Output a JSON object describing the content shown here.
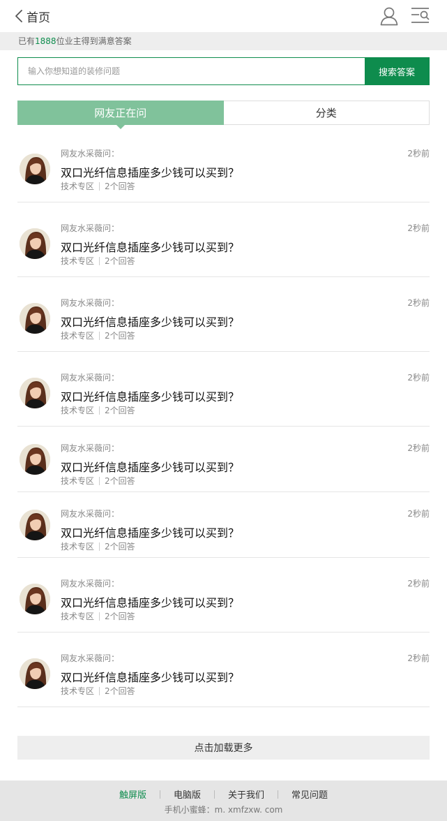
{
  "header": {
    "back_label": "首页",
    "icons": [
      "chevron-left-icon",
      "user-icon",
      "menu-search-icon"
    ]
  },
  "stats": {
    "prefix": "已有",
    "count": "1888",
    "suffix": "位业主得到满意答案"
  },
  "search": {
    "placeholder": "输入你想知道的装修问题",
    "value": "",
    "button_label": "搜索答案"
  },
  "tabs": [
    {
      "label": "网友正在问",
      "active": true
    },
    {
      "label": "分类",
      "active": false
    }
  ],
  "questions": [
    {
      "asker": "网友水采薇问：",
      "time": "2秒前",
      "title": "双口光纤信息插座多少钱可以买到？",
      "category": "技术专区",
      "answers": "2个回答"
    },
    {
      "asker": "网友水采薇问：",
      "time": "2秒前",
      "title": "双口光纤信息插座多少钱可以买到？",
      "category": "技术专区",
      "answers": "2个回答"
    },
    {
      "asker": "网友水采薇问：",
      "time": "2秒前",
      "title": "双口光纤信息插座多少钱可以买到？",
      "category": "技术专区",
      "answers": "2个回答"
    },
    {
      "asker": "网友水采薇问：",
      "time": "2秒前",
      "title": "双口光纤信息插座多少钱可以买到？",
      "category": "技术专区",
      "answers": "2个回答"
    },
    {
      "asker": "网友水采薇问：",
      "time": "2秒前",
      "title": "双口光纤信息插座多少钱可以买到？",
      "category": "技术专区",
      "answers": "2个回答"
    },
    {
      "asker": "网友水采薇问：",
      "time": "2秒前",
      "title": "双口光纤信息插座多少钱可以买到？",
      "category": "技术专区",
      "answers": "2个回答"
    },
    {
      "asker": "网友水采薇问：",
      "time": "2秒前",
      "title": "双口光纤信息插座多少钱可以买到？",
      "category": "技术专区",
      "answers": "2个回答"
    },
    {
      "asker": "网友水采薇问：",
      "time": "2秒前",
      "title": "双口光纤信息插座多少钱可以买到？",
      "category": "技术专区",
      "answers": "2个回答"
    }
  ],
  "load_more": "点击加载更多",
  "footer": {
    "links": [
      "触屏版",
      "电脑版",
      "关于我们",
      "常见问题"
    ],
    "current_link": "触屏版",
    "site_label": "手机小蜜蜂：",
    "site_url": "m. xmfzxw. com"
  },
  "colors": {
    "brand_green": "#0e8c4d",
    "tab_active": "#80c29b",
    "divider": "#e5e5e5"
  }
}
